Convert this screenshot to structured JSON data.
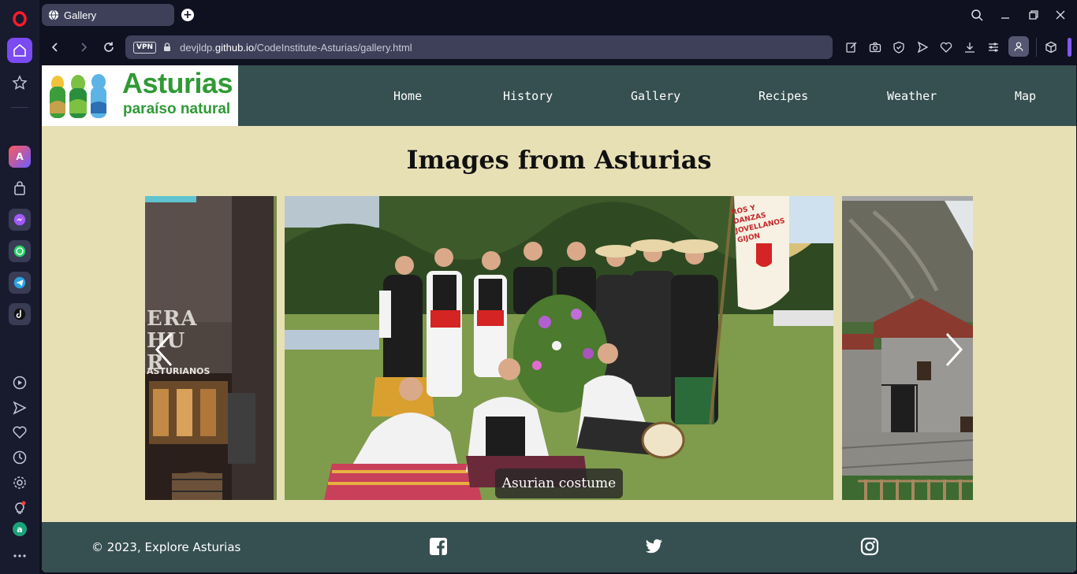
{
  "browser": {
    "tab_title": "Gallery",
    "new_tab_symbol": "+",
    "vpn_label": "VPN",
    "url_prefix": "devjldp.",
    "url_domain": "github.io",
    "url_path": "/CodeInstitute-Asturias/gallery.html"
  },
  "site": {
    "logo_title": "Asturias",
    "logo_subtitle": "paraíso natural",
    "nav": [
      "Home",
      "History",
      "Gallery",
      "Recipes",
      "Weather",
      "Map"
    ],
    "page_title": "Images from Asturias",
    "carousel": {
      "caption": "Asurian costume",
      "sign_text": "ERA HUR",
      "sign_subtext": "ASTURIANOS",
      "banner_text": "ROS Y DANZAS JOVELLANOS GIJON"
    },
    "footer": {
      "copyright": "© 2023, Explore Asturias"
    }
  },
  "colors": {
    "header_bg": "#364f50",
    "page_bg": "#e8e0b5",
    "logo_green": "#2f9a34",
    "indicator": "#5fc4cf",
    "browser_bg": "#0f1020"
  }
}
